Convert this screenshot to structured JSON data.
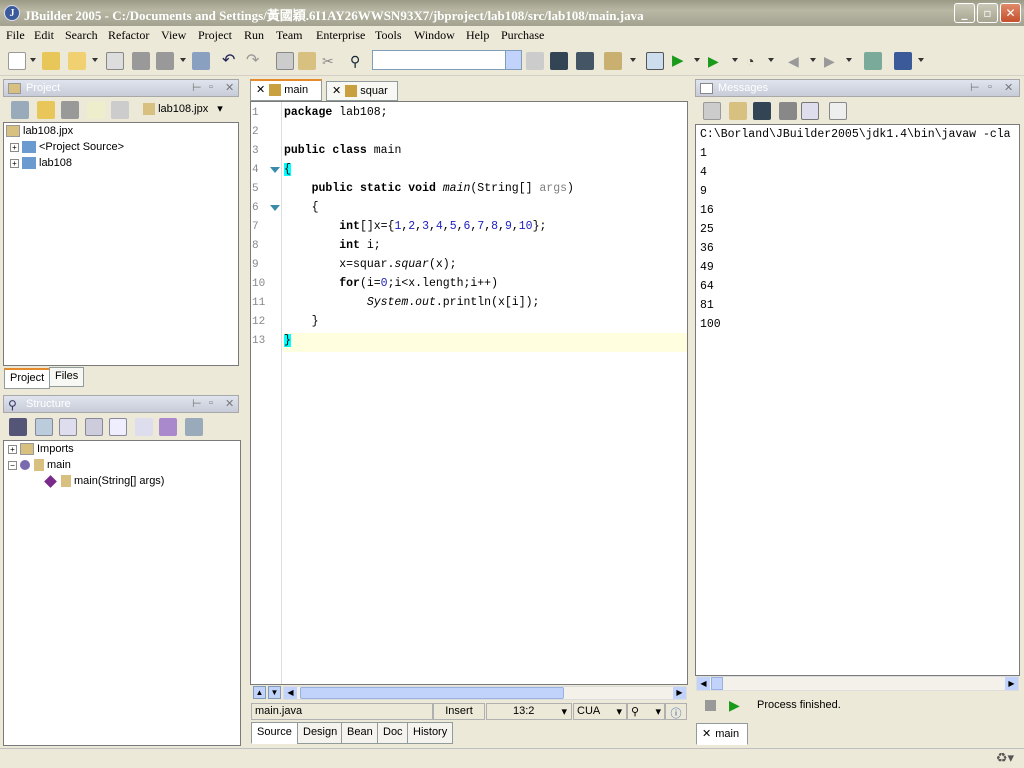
{
  "window": {
    "title": "JBuilder 2005 - C:/Documents and Settings/黃國穎.6I1AY26WWSN93X7/jbproject/lab108/src/lab108/main.java"
  },
  "menu": [
    "File",
    "Edit",
    "Search",
    "Refactor",
    "View",
    "Project",
    "Run",
    "Team",
    "Enterprise",
    "Tools",
    "Window",
    "Help",
    "Purchase"
  ],
  "project_panel": {
    "title": "Project",
    "project_file": "lab108.jpx",
    "tree": {
      "root": "lab108.jpx",
      "children": [
        "<Project Source>",
        "lab108"
      ]
    },
    "tabs": [
      "Project",
      "Files"
    ]
  },
  "structure_panel": {
    "title": "Structure",
    "tree": {
      "imports": "Imports",
      "class": "main",
      "method": "main(String[] args)"
    }
  },
  "editor": {
    "tabs": [
      "main",
      "squar"
    ],
    "line_numbers": [
      "1",
      "2",
      "3",
      "4",
      "5",
      "6",
      "7",
      "8",
      "9",
      "10",
      "11",
      "12",
      "13"
    ],
    "lines": [
      "package lab108;",
      "",
      "public class main",
      "{",
      "    public static void main(String[] args)",
      "    {",
      "        int[]x={1,2,3,4,5,6,7,8,9,10};",
      "        int i;",
      "        x=squar.squar(x);",
      "        for(i=0;i<x.length;i++)",
      "            System.out.println(x[i]);",
      "    }",
      "}"
    ],
    "status": {
      "file": "main.java",
      "mode": "Insert",
      "position": "13:2",
      "keymap": "CUA"
    },
    "bottom_tabs": [
      "Source",
      "Design",
      "Bean",
      "Doc",
      "History"
    ]
  },
  "messages_panel": {
    "title": "Messages",
    "command": "C:\\Borland\\JBuilder2005\\jdk1.4\\bin\\javaw -cla",
    "output": [
      "1",
      "4",
      "9",
      "16",
      "25",
      "36",
      "49",
      "64",
      "81",
      "100"
    ],
    "status": "Process finished.",
    "tab": "main"
  },
  "colors": {
    "highlight_line": "#ffffe0",
    "bracket_match": "#00ffff",
    "title_bar": "#a9a897"
  }
}
